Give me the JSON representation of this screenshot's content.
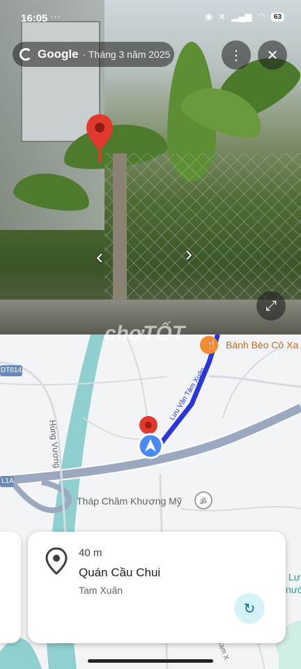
{
  "status_bar": {
    "time": "16:05",
    "dots": "···",
    "battery": "63"
  },
  "street_view": {
    "brand": "Google",
    "date_label": "· Tháng 3 năm 2025",
    "more_icon": "more-vert-icon",
    "close_icon": "close-icon",
    "expand_icon": "expand-icon"
  },
  "watermark": "chợTỐT",
  "map": {
    "labels": {
      "poi_restaurant": "Bánh Bèo Cô Xa",
      "road_dt614": "DT614",
      "road_hung_vuong": "Hùng Vương",
      "road_1a": "L1A",
      "road_tam_xuan": "Lưu Văn Tám Xuân",
      "poi_temple": "Tháp Chăm Khương Mỹ",
      "edge_lu": "Lư",
      "edge_nuo": "nướ",
      "bottom_road": "Tam X"
    },
    "accent_route": "#2b36d9",
    "river_color": "#8fd0cf"
  },
  "place_card": {
    "distance": "40 m",
    "name": "Quán Cầu Chui",
    "area": "Tam Xuân"
  }
}
